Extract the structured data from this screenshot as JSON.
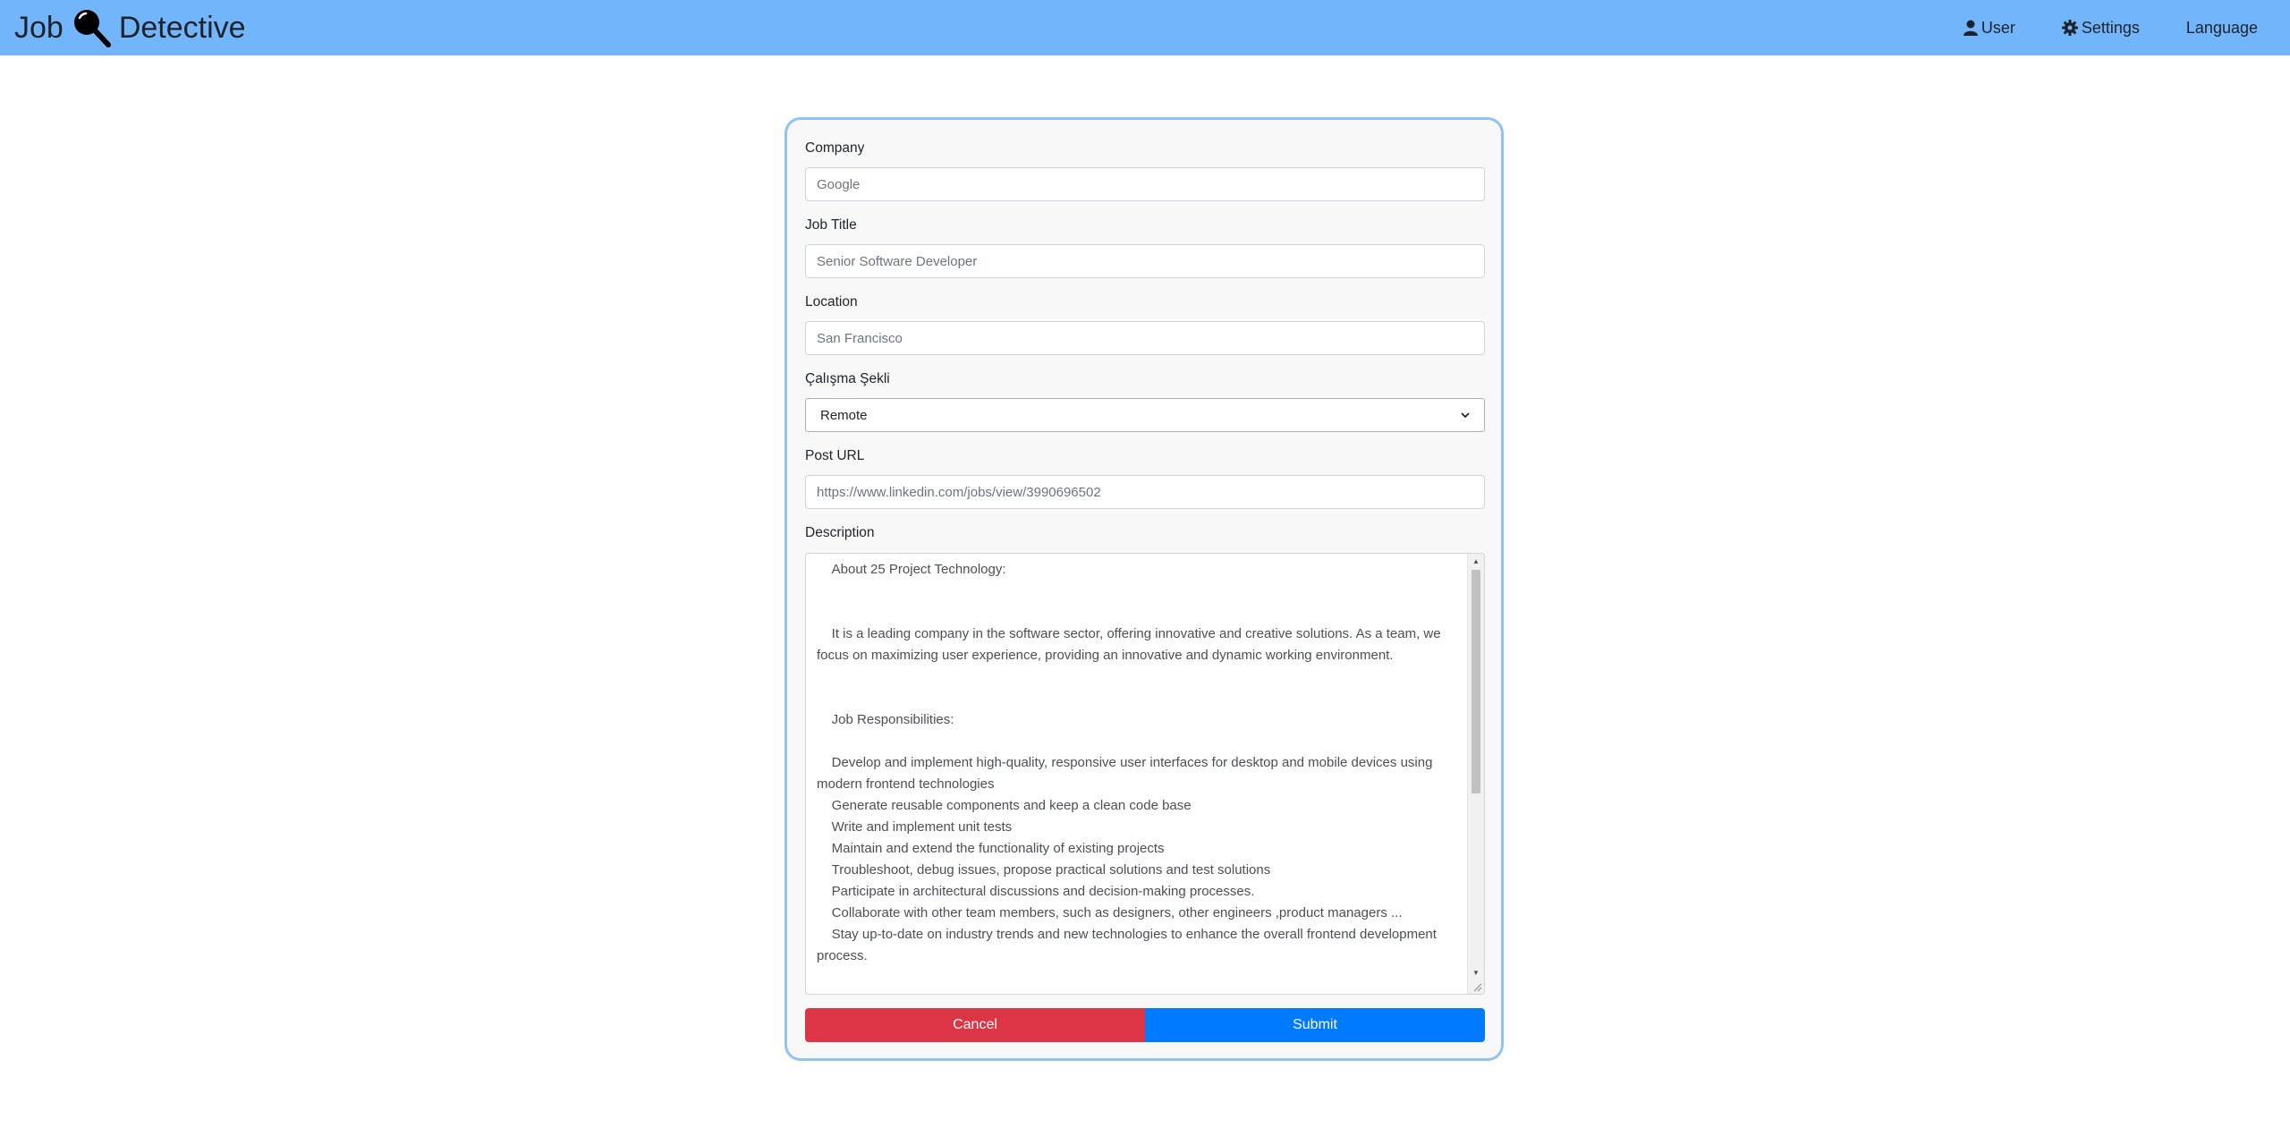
{
  "navbar": {
    "brand_left": "Job",
    "brand_right": "Detective",
    "brand_icon": "magnifier-icon",
    "links": {
      "user": "User",
      "settings": "Settings",
      "language": "Language"
    },
    "background_color": "#73b5fb"
  },
  "form": {
    "company": {
      "label": "Company",
      "placeholder": "Google"
    },
    "job_title": {
      "label": "Job Title",
      "placeholder": "Senior Software Developer"
    },
    "location": {
      "label": "Location",
      "placeholder": "San Francisco"
    },
    "work_type": {
      "label": "Çalışma Şekli",
      "selected": "Remote"
    },
    "post_url": {
      "label": "Post URL",
      "placeholder": "https://www.linkedin.com/jobs/view/3990696502"
    },
    "description": {
      "label": "Description",
      "value": "    About 25 Project Technology:\n\n\n    It is a leading company in the software sector, offering innovative and creative solutions. As a team, we focus on maximizing user experience, providing an innovative and dynamic working environment.\n\n\n    Job Responsibilities:\n\n    Develop and implement high-quality, responsive user interfaces for desktop and mobile devices using modern frontend technologies\n    Generate reusable components and keep a clean code base\n    Write and implement unit tests\n    Maintain and extend the functionality of existing projects\n    Troubleshoot, debug issues, propose practical solutions and test solutions\n    Participate in architectural discussions and decision-making processes.\n    Collaborate with other team members, such as designers, other engineers ,product managers ...\n    Stay up-to-date on industry trends and new technologies to enhance the overall frontend development process."
    },
    "buttons": {
      "cancel": "Cancel",
      "submit": "Submit"
    },
    "colors": {
      "cancel": "#dc3545",
      "submit": "#007bff",
      "card_border": "#8fc2f5"
    }
  }
}
